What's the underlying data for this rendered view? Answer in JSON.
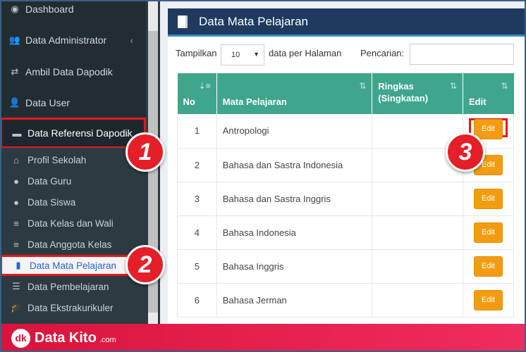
{
  "sidebar": {
    "items": [
      {
        "label": "Dashboard",
        "icon": "dashboard-icon",
        "glyph": "◉"
      },
      {
        "label": "Data Administrator",
        "icon": "users-icon",
        "glyph": "👥",
        "chevron": "‹"
      },
      {
        "label": "Ambil Data Dapodik",
        "icon": "shuffle-icon",
        "glyph": "⇄"
      },
      {
        "label": "Data User",
        "icon": "user-group-icon",
        "glyph": "👤"
      },
      {
        "label": "Data Referensi Dapodik",
        "icon": "desktop-icon",
        "glyph": "▬",
        "chevron": "⌄"
      }
    ],
    "subitems": [
      {
        "label": "Profil Sekolah",
        "icon": "home-icon",
        "glyph": "⌂"
      },
      {
        "label": "Data Guru",
        "icon": "user-icon",
        "glyph": "●"
      },
      {
        "label": "Data Siswa",
        "icon": "user-icon",
        "glyph": "●"
      },
      {
        "label": "Data Kelas dan Wali",
        "icon": "list-icon",
        "glyph": "≡"
      },
      {
        "label": "Data Anggota Kelas",
        "icon": "list-icon",
        "glyph": "≡"
      },
      {
        "label": "Data Mata Pelajaran",
        "icon": "book-icon",
        "glyph": "▮"
      },
      {
        "label": "Data Pembelajaran",
        "icon": "server-icon",
        "glyph": "☰"
      },
      {
        "label": "Data Ekstrakurikuler",
        "icon": "graduation-cap-icon",
        "glyph": "🎓"
      }
    ]
  },
  "badges": [
    "1",
    "2",
    "3"
  ],
  "panel": {
    "title": "Data Mata Pelajaran",
    "show_label": "Tampilkan",
    "page_size": "10",
    "per_page_label": "data per Halaman",
    "search_label": "Pencarian:",
    "search_value": ""
  },
  "table": {
    "headers": {
      "no": "No",
      "mapel": "Mata Pelajaran",
      "ringkas": "Ringkas (Singkatan)",
      "edit": "Edit"
    },
    "rows": [
      {
        "no": "1",
        "mapel": "Antropologi",
        "ringkas": "",
        "edit": "Edit"
      },
      {
        "no": "2",
        "mapel": "Bahasa dan Sastra Indonesia",
        "ringkas": "",
        "edit": "Edit"
      },
      {
        "no": "3",
        "mapel": "Bahasa dan Sastra Inggris",
        "ringkas": "",
        "edit": "Edit"
      },
      {
        "no": "4",
        "mapel": "Bahasa Indonesia",
        "ringkas": "",
        "edit": "Edit"
      },
      {
        "no": "5",
        "mapel": "Bahasa Inggris",
        "ringkas": "",
        "edit": "Edit"
      },
      {
        "no": "6",
        "mapel": "Bahasa Jerman",
        "ringkas": "",
        "edit": "Edit"
      }
    ]
  },
  "footer": {
    "logo": "dk",
    "brand": "Data Kito",
    "suffix": ".com"
  },
  "colors": {
    "sidebar": "#222d32",
    "header": "#1e3a5f",
    "table_head": "#3fa68c",
    "edit_button": "#f39c12",
    "highlight": "#e0191f",
    "footer": "#d9143c"
  }
}
